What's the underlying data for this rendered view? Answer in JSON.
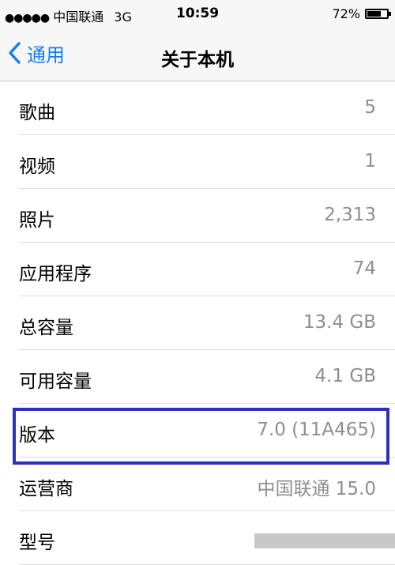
{
  "status_bar": {
    "signal": "●●●●●",
    "carrier": "中国联通",
    "network": "3G",
    "time": "10:59",
    "battery_percent": "72%",
    "battery_level": 0.72
  },
  "nav": {
    "back_label": "通用",
    "title": "关于本机"
  },
  "rows": [
    {
      "label": "歌曲",
      "value": "5"
    },
    {
      "label": "视频",
      "value": "1"
    },
    {
      "label": "照片",
      "value": "2,313"
    },
    {
      "label": "应用程序",
      "value": "74"
    },
    {
      "label": "总容量",
      "value": "13.4 GB"
    },
    {
      "label": "可用容量",
      "value": "4.1 GB"
    },
    {
      "label": "版本",
      "value": "7.0 (11A465)"
    },
    {
      "label": "运营商",
      "value": "中国联通 15.0"
    },
    {
      "label": "型号",
      "value": ""
    }
  ],
  "colors": {
    "accent": "#1a7cf2",
    "highlight": "#2f2fb8",
    "value_text": "#8e8e93"
  }
}
